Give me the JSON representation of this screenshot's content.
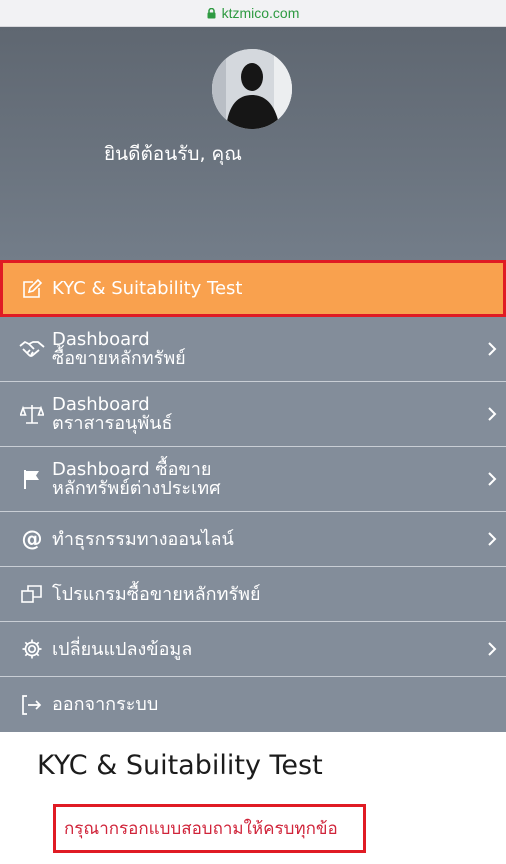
{
  "browser": {
    "domain": "ktzmico.com"
  },
  "profile": {
    "welcome_text": "ยินดีต้อนรับ, คุณ"
  },
  "menu": {
    "items": [
      {
        "line1": "KYC & Suitability Test",
        "line2": ""
      },
      {
        "line1": "Dashboard",
        "line2": "ซื้อขายหลักทรัพย์"
      },
      {
        "line1": "Dashboard",
        "line2": "ตราสารอนุพันธ์"
      },
      {
        "line1": "Dashboard ซื้อขาย",
        "line2": "หลักทรัพย์ต่างประเทศ"
      },
      {
        "line1": "ทำธุรกรรมทางออนไลน์",
        "line2": ""
      },
      {
        "line1": "โปรแกรมซื้อขายหลักทรัพย์",
        "line2": ""
      },
      {
        "line1": "เปลี่ยนแปลงข้อมูล",
        "line2": ""
      },
      {
        "line1": "ออกจากระบบ",
        "line2": ""
      }
    ]
  },
  "main": {
    "title": "KYC & Suitability Test",
    "warning": "กรุณากรอกแบบสอบถามให้ครบทุกข้อ"
  },
  "colors": {
    "active_item": "#f9a14e",
    "menu_bg": "#838d9a",
    "highlight_border": "#e01b24",
    "warning_text": "#d0243a",
    "url_green": "#2e9a41"
  }
}
